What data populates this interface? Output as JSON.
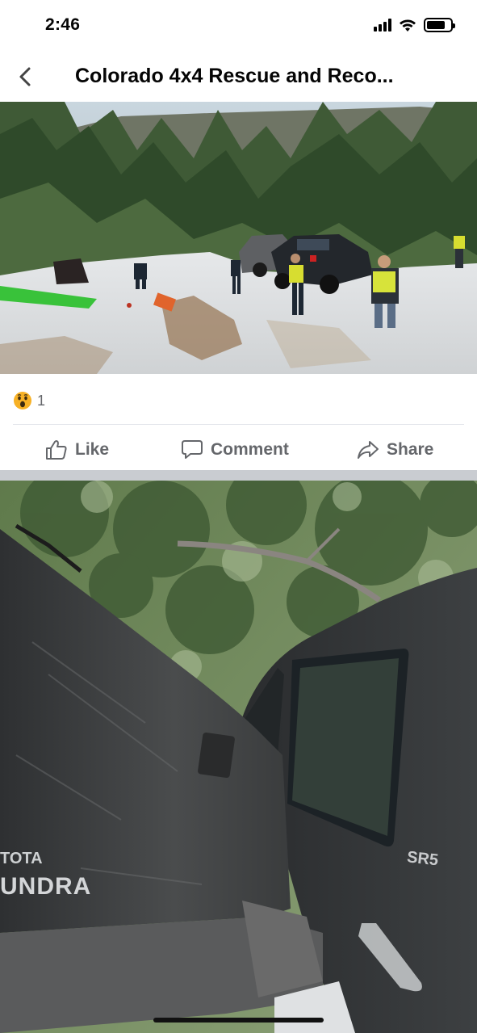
{
  "status_bar": {
    "time": "2:46"
  },
  "nav": {
    "title": "Colorado 4x4 Rescue and Reco...",
    "back_icon": "chevron-left-icon"
  },
  "post": {
    "reaction": {
      "emoji": "wow-reaction-icon",
      "count": "1"
    },
    "actions": {
      "like": "Like",
      "comment": "Comment",
      "share": "Share"
    }
  },
  "photo2": {
    "badge_line1": "TOTA",
    "badge_line2": "UNDRA",
    "trim": "SR5"
  },
  "colors": {
    "separator": "#c9ccd1",
    "action_text": "#65676b",
    "wow": "#f7b125"
  }
}
